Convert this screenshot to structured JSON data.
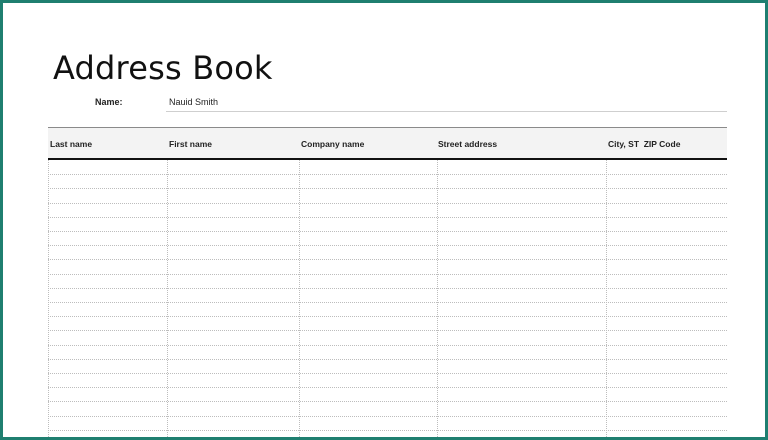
{
  "document": {
    "title": "Address Book",
    "name_label": "Name:",
    "name_value": "Nauid Smith"
  },
  "table": {
    "columns": [
      "Last name",
      "First name",
      "Company name",
      "Street address",
      "City, ST  ZIP Code"
    ],
    "rows": []
  },
  "colors": {
    "frame_border": "#1f7f70",
    "header_background": "#f3f3f3",
    "header_rule": "#111111"
  }
}
